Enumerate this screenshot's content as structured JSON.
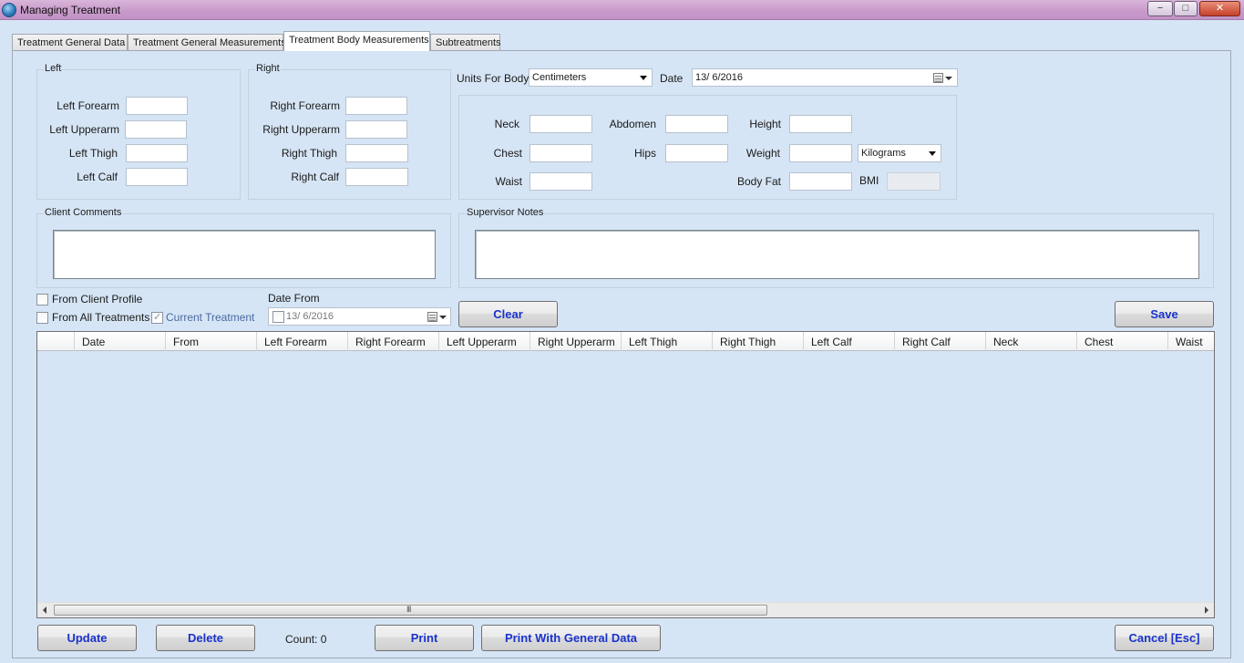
{
  "window": {
    "title": "Managing Treatment",
    "minimize": "−",
    "maximize": "□",
    "close": "✕"
  },
  "tabs": [
    {
      "label": "Treatment General Data"
    },
    {
      "label": "Treatment General Measurements"
    },
    {
      "label": "Treatment Body Measurements"
    },
    {
      "label": "Subtreatments"
    }
  ],
  "left_group": {
    "title": "Left",
    "fields": [
      "Left Forearm",
      "Left Upperarm",
      "Left Thigh",
      "Left Calf"
    ]
  },
  "right_group": {
    "title": "Right",
    "fields": [
      "Right Forearm",
      "Right Upperarm",
      "Right Thigh",
      "Right Calf"
    ]
  },
  "units": {
    "label": "Units For Body",
    "value": "Centimeters"
  },
  "date": {
    "label": "Date",
    "value": "13/  6/2016"
  },
  "body": {
    "neck": "Neck",
    "chest": "Chest",
    "waist": "Waist",
    "abdomen": "Abdomen",
    "hips": "Hips",
    "height": "Height",
    "weight": "Weight",
    "body_fat": "Body Fat",
    "bmi": "BMI",
    "weight_unit": "Kilograms"
  },
  "comments": {
    "client": "Client Comments",
    "supervisor": "Supervisor Notes"
  },
  "filters": {
    "from_client_profile": "From Client Profile",
    "from_all_treatments": "From All Treatments",
    "current_treatment": "Current Treatment",
    "date_from_label": "Date From",
    "date_from_value": "13/  6/2016"
  },
  "buttons": {
    "clear": "Clear",
    "save": "Save",
    "update": "Update",
    "delete": "Delete",
    "print": "Print",
    "print_general": "Print With General Data",
    "cancel": "Cancel [Esc]"
  },
  "count_label": "Count: 0",
  "grid": {
    "columns": [
      "Date",
      "From",
      "Left Forearm",
      "Right Forearm",
      "Left Upperarm",
      "Right Upperarm",
      "Left Thigh",
      "Right Thigh",
      "Left Calf",
      "Right Calf",
      "Neck",
      "Chest",
      "Waist"
    ],
    "scroll_grip": "III"
  }
}
